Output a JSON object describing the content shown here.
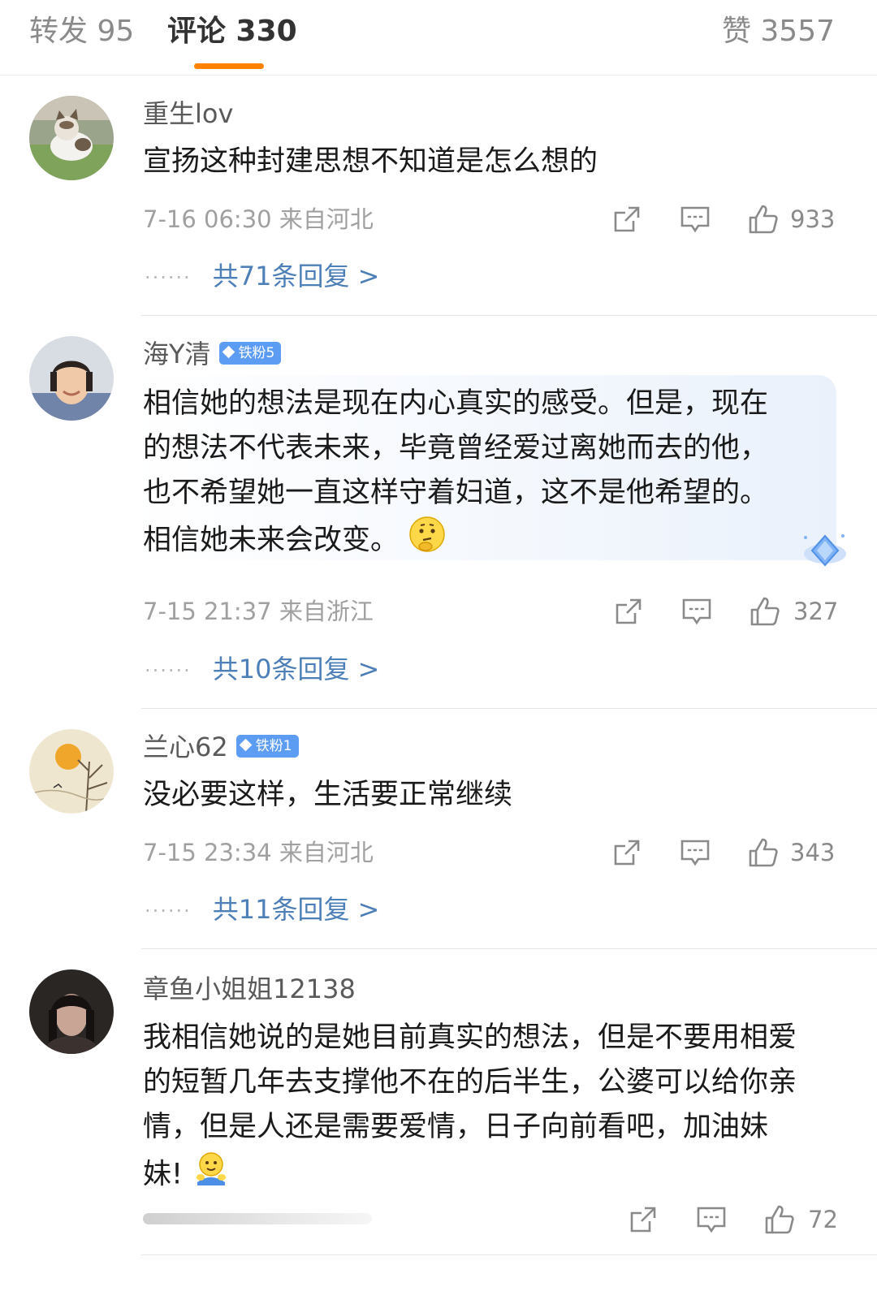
{
  "tabs": {
    "repost": "转发 95",
    "comments": "评论 330",
    "likes": "赞 3557"
  },
  "colors": {
    "accent": "#ff8200",
    "link": "#4d7fb8",
    "badge": "#5c9cf2"
  },
  "comments": [
    {
      "username": "重生lov",
      "text": "宣扬这种封建思想不知道是怎么想的",
      "meta": "7-16 06:30 来自河北",
      "likes": "933",
      "replies": "共71条回复 >"
    },
    {
      "username": "海Y清",
      "badge": "铁粉5",
      "text_lines": [
        "相信她的想法是现在内心真实的感受。但是，现在",
        "的想法不代表未来，毕竟曾经爱过离她而去的他，",
        "也不希望她一直这样守着妇道，这不是他希望的。",
        "相信她未来会改变。"
      ],
      "emoji": "thinking-emoji",
      "meta": "7-15 21:37 来自浙江",
      "likes": "327",
      "replies": "共10条回复 >"
    },
    {
      "username": "兰心62",
      "badge": "铁粉1",
      "text": "没必要这样，生活要正常继续",
      "meta": "7-15 23:34 来自河北",
      "likes": "343",
      "replies": "共11条回复 >"
    },
    {
      "username": "章鱼小姐姐12138",
      "text_lines": [
        "我相信她说的是她目前真实的想法，但是不要用相爱",
        "的短暂几年去支撑他不在的后半生，公婆可以给你亲",
        "情，但是人还是需要爱情，日子向前看吧，加油妹",
        "妹!"
      ],
      "emoji": "hug-emoji",
      "likes": "72"
    }
  ],
  "icons": {
    "share": "share-icon",
    "comment": "comment-icon",
    "like": "thumbs-up-icon"
  }
}
